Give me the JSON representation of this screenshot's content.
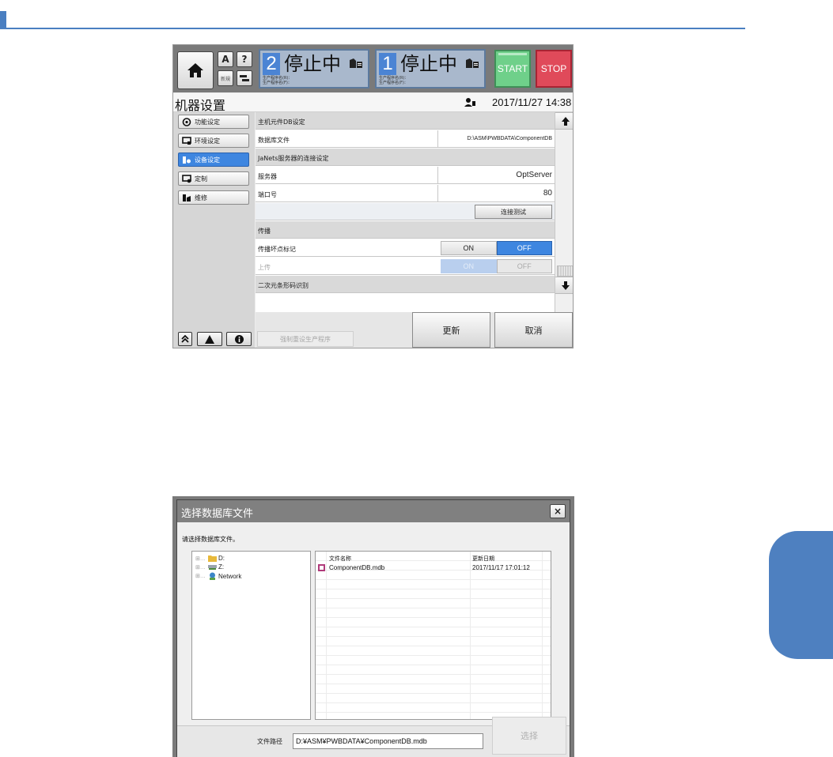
{
  "screen1": {
    "header": {
      "mini_buttons": {
        "top_left": "A",
        "help": "?",
        "bottom_left": "新規"
      },
      "lanes": [
        {
          "number": "2",
          "status": "停止中",
          "line1": "生产程序名(R)：",
          "line2": "生产程序名(F)："
        },
        {
          "number": "1",
          "status": "停止中",
          "line1": "生产程序名(R)：",
          "line2": "生产程序名(F)："
        }
      ],
      "start_label": "START",
      "stop_label": "STOP",
      "colors": {
        "start": "#6fd08a",
        "stop": "#e04a5a",
        "lane_number": "#4b84d4",
        "accent": "#3e86e0"
      }
    },
    "title": "机器设置",
    "datetime": "2017/11/27 14:38",
    "sidebar": {
      "items": [
        {
          "label": "功能设定",
          "icon": "function-settings-icon",
          "active": false
        },
        {
          "label": "环境设定",
          "icon": "environment-settings-icon",
          "active": false
        },
        {
          "label": "设备设定",
          "icon": "device-settings-icon",
          "active": true
        },
        {
          "label": "定制",
          "icon": "customize-icon",
          "active": false
        },
        {
          "label": "维修",
          "icon": "maintenance-icon",
          "active": false
        }
      ]
    },
    "content": {
      "section_db": "主机元件DB设定",
      "db_file_label": "数据库文件",
      "db_file_value": "D:\\ASM\\PWBDATA\\ComponentDB",
      "section_janets": "JaNets服务器的连接设定",
      "server_label": "服务器",
      "server_value": "OptServer",
      "port_label": "端口号",
      "port_value": "80",
      "test_button": "连接测试",
      "section_broadcast": "传播",
      "bad_mark_label": "传播坏点标记",
      "bad_mark_on": "ON",
      "bad_mark_off": "OFF",
      "upload_label": "上传",
      "upload_on": "ON",
      "upload_off": "OFF",
      "section_2d": "二次元条形码识别"
    },
    "bottom": {
      "force_reset": "强制重设生产程序",
      "update": "更新",
      "cancel": "取消"
    }
  },
  "screen2": {
    "title": "选择数据库文件",
    "close": "×",
    "prompt": "请选择数据库文件。",
    "tree": [
      {
        "expander": "⊞…",
        "label": "D:",
        "icon": "folder-icon"
      },
      {
        "expander": "⊞…",
        "label": "Z:",
        "icon": "network-drive-icon"
      },
      {
        "expander": "⊞…",
        "label": "Network",
        "icon": "network-icon"
      }
    ],
    "list": {
      "columns": [
        "文件名称",
        "更新日期"
      ],
      "rows": [
        {
          "name": "ComponentDB.mdb",
          "date": "2017/11/17 17:01:12"
        }
      ]
    },
    "path_label": "文件路径",
    "path_value": "D:¥ASM¥PWBDATA¥ComponentDB.mdb",
    "select_button": "选择"
  }
}
